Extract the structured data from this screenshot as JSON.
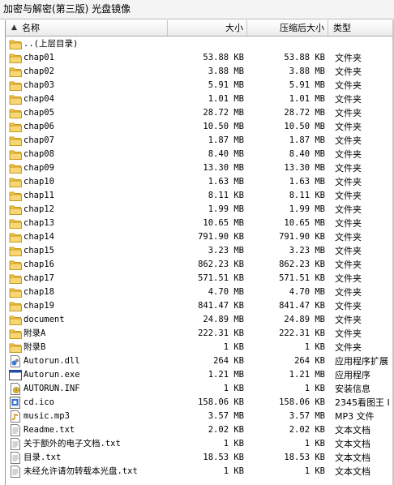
{
  "window": {
    "title": "加密与解密(第三版) 光盘镜像"
  },
  "columns": {
    "name": "名称",
    "size": "大小",
    "compressed": "压缩后大小",
    "type": "类型"
  },
  "rows": [
    {
      "name": "..(上层目录)",
      "size": "",
      "compressed": "",
      "type": "",
      "icon": "folder-up-icon"
    },
    {
      "name": "chap01",
      "size": "53.88 KB",
      "compressed": "53.88 KB",
      "type": "文件夹",
      "icon": "folder-icon"
    },
    {
      "name": "chap02",
      "size": "3.88 MB",
      "compressed": "3.88 MB",
      "type": "文件夹",
      "icon": "folder-icon"
    },
    {
      "name": "chap03",
      "size": "5.91 MB",
      "compressed": "5.91 MB",
      "type": "文件夹",
      "icon": "folder-icon"
    },
    {
      "name": "chap04",
      "size": "1.01 MB",
      "compressed": "1.01 MB",
      "type": "文件夹",
      "icon": "folder-icon"
    },
    {
      "name": "chap05",
      "size": "28.72 MB",
      "compressed": "28.72 MB",
      "type": "文件夹",
      "icon": "folder-icon"
    },
    {
      "name": "chap06",
      "size": "10.50 MB",
      "compressed": "10.50 MB",
      "type": "文件夹",
      "icon": "folder-icon"
    },
    {
      "name": "chap07",
      "size": "1.87 MB",
      "compressed": "1.87 MB",
      "type": "文件夹",
      "icon": "folder-icon"
    },
    {
      "name": "chap08",
      "size": "8.40 MB",
      "compressed": "8.40 MB",
      "type": "文件夹",
      "icon": "folder-icon"
    },
    {
      "name": "chap09",
      "size": "13.30 MB",
      "compressed": "13.30 MB",
      "type": "文件夹",
      "icon": "folder-icon"
    },
    {
      "name": "chap10",
      "size": "1.63 MB",
      "compressed": "1.63 MB",
      "type": "文件夹",
      "icon": "folder-icon"
    },
    {
      "name": "chap11",
      "size": "8.11 KB",
      "compressed": "8.11 KB",
      "type": "文件夹",
      "icon": "folder-icon"
    },
    {
      "name": "chap12",
      "size": "1.99 MB",
      "compressed": "1.99 MB",
      "type": "文件夹",
      "icon": "folder-icon"
    },
    {
      "name": "chap13",
      "size": "10.65 MB",
      "compressed": "10.65 MB",
      "type": "文件夹",
      "icon": "folder-icon"
    },
    {
      "name": "chap14",
      "size": "791.90 KB",
      "compressed": "791.90 KB",
      "type": "文件夹",
      "icon": "folder-icon"
    },
    {
      "name": "chap15",
      "size": "3.23 MB",
      "compressed": "3.23 MB",
      "type": "文件夹",
      "icon": "folder-icon"
    },
    {
      "name": "chap16",
      "size": "862.23 KB",
      "compressed": "862.23 KB",
      "type": "文件夹",
      "icon": "folder-icon"
    },
    {
      "name": "chap17",
      "size": "571.51 KB",
      "compressed": "571.51 KB",
      "type": "文件夹",
      "icon": "folder-icon"
    },
    {
      "name": "chap18",
      "size": "4.70 MB",
      "compressed": "4.70 MB",
      "type": "文件夹",
      "icon": "folder-icon"
    },
    {
      "name": "chap19",
      "size": "841.47 KB",
      "compressed": "841.47 KB",
      "type": "文件夹",
      "icon": "folder-icon"
    },
    {
      "name": "document",
      "size": "24.89 MB",
      "compressed": "24.89 MB",
      "type": "文件夹",
      "icon": "folder-icon"
    },
    {
      "name": "附录A",
      "size": "222.31 KB",
      "compressed": "222.31 KB",
      "type": "文件夹",
      "icon": "folder-icon"
    },
    {
      "name": "附录B",
      "size": "1 KB",
      "compressed": "1 KB",
      "type": "文件夹",
      "icon": "folder-icon"
    },
    {
      "name": "Autorun.dll",
      "size": "264 KB",
      "compressed": "264 KB",
      "type": "应用程序扩展",
      "icon": "dll-icon"
    },
    {
      "name": "Autorun.exe",
      "size": "1.21 MB",
      "compressed": "1.21 MB",
      "type": "应用程序",
      "icon": "exe-icon"
    },
    {
      "name": "AUTORUN.INF",
      "size": "1 KB",
      "compressed": "1 KB",
      "type": "安装信息",
      "icon": "inf-icon"
    },
    {
      "name": "cd.ico",
      "size": "158.06 KB",
      "compressed": "158.06 KB",
      "type": "2345看图王 I",
      "icon": "ico-file-icon"
    },
    {
      "name": "music.mp3",
      "size": "3.57 MB",
      "compressed": "3.57 MB",
      "type": "MP3 文件",
      "icon": "music-file-icon"
    },
    {
      "name": "Readme.txt",
      "size": "2.02 KB",
      "compressed": "2.02 KB",
      "type": "文本文档",
      "icon": "text-file-icon"
    },
    {
      "name": "关于额外的电子文档.txt",
      "size": "1 KB",
      "compressed": "1 KB",
      "type": "文本文档",
      "icon": "text-file-icon"
    },
    {
      "name": "目录.txt",
      "size": "18.53 KB",
      "compressed": "18.53 KB",
      "type": "文本文档",
      "icon": "text-file-icon"
    },
    {
      "name": "未经允许请勿转载本光盘.txt",
      "size": "1 KB",
      "compressed": "1 KB",
      "type": "文本文档",
      "icon": "text-file-icon"
    }
  ]
}
